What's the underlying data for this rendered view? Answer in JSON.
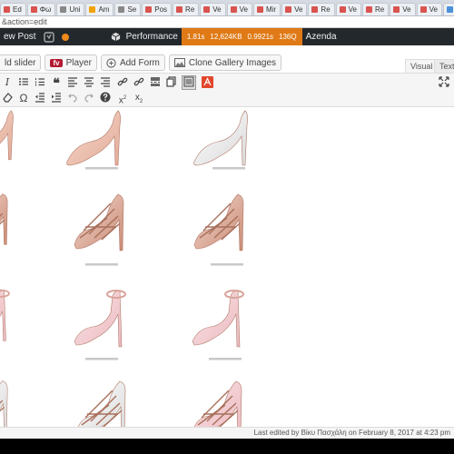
{
  "browser": {
    "tabs": [
      {
        "label": "Ed",
        "color": "#d9534f"
      },
      {
        "label": "Φω",
        "color": "#d9534f"
      },
      {
        "label": "Uni",
        "color": "#888888"
      },
      {
        "label": "Am",
        "color": "#f0a30a"
      },
      {
        "label": "Se",
        "color": "#888888"
      },
      {
        "label": "Pos",
        "color": "#d9534f"
      },
      {
        "label": "Re",
        "color": "#d9534f"
      },
      {
        "label": "Ve",
        "color": "#d9534f"
      },
      {
        "label": "Ve",
        "color": "#d9534f"
      },
      {
        "label": "Mir",
        "color": "#d9534f"
      },
      {
        "label": "Ve",
        "color": "#d9534f"
      },
      {
        "label": "Re",
        "color": "#d9534f"
      },
      {
        "label": "Ve",
        "color": "#d9534f"
      },
      {
        "label": "Re",
        "color": "#d9534f"
      },
      {
        "label": "Ve",
        "color": "#d9534f"
      },
      {
        "label": "Ve",
        "color": "#d9534f"
      },
      {
        "label": "Spr",
        "color": "#4a90d9"
      },
      {
        "label": "Spr",
        "color": "#4a90d9"
      },
      {
        "label": "W Ng",
        "color": "#4a90d9"
      },
      {
        "label": "Re",
        "color": "#d9534f"
      }
    ],
    "url": "&action=edit"
  },
  "adminbar": {
    "new_post": "ew Post",
    "performance_label": "Performance",
    "metrics": [
      "1.81s",
      "12,624KB",
      "0.9921s",
      "136Q"
    ],
    "site": "Azenda"
  },
  "media_buttons": {
    "slider": "ld slider",
    "player_badge": "fv",
    "player": "Player",
    "add_form": "Add Form",
    "clone_gallery": "Clone Gallery Images"
  },
  "editor_tabs": {
    "visual": "Visual",
    "text": "Text"
  },
  "icons": [
    "italic-icon",
    "bullet-list-icon",
    "numbered-list-icon",
    "blockquote-icon",
    "align-left-icon",
    "align-center-icon",
    "align-right-icon",
    "link-icon",
    "unlink-icon",
    "read-more-icon",
    "fullscreen-icon",
    "toolbar-toggle-icon",
    "expand-icon",
    "eraser-icon",
    "special-character-icon",
    "outdent-icon",
    "indent-icon",
    "undo-icon",
    "redo-icon",
    "help-icon",
    "superscript-icon",
    "subscript-icon"
  ],
  "status": {
    "last_edited": "Last edited by Βίκυ Πασχάλη on February 8, 2017 at 4:23 pm"
  }
}
